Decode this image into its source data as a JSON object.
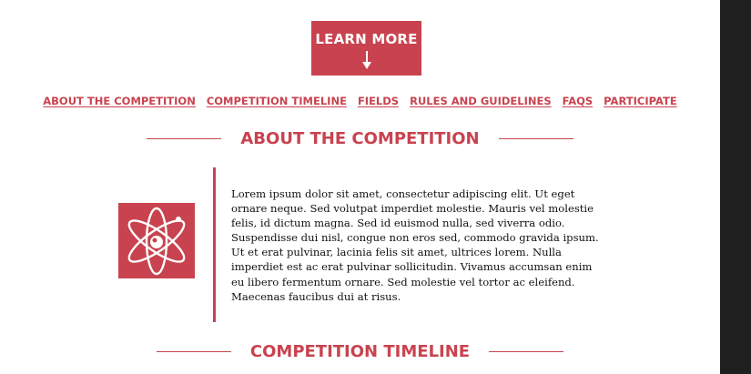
{
  "cta": {
    "label": "LEARN MORE",
    "icon": "arrow-down-icon"
  },
  "nav": {
    "items": [
      {
        "label": "About the Competition"
      },
      {
        "label": "Competition Timeline"
      },
      {
        "label": "Fields"
      },
      {
        "label": "Rules and Guidelines"
      },
      {
        "label": "FAQs"
      },
      {
        "label": "Participate"
      }
    ]
  },
  "about": {
    "heading": "ABOUT THE COMPETITION",
    "logo_icon": "atom-icon",
    "body": "Lorem ipsum dolor sit amet, consectetur adipiscing elit. Ut eget ornare neque. Sed volutpat imperdiet molestie. Mauris vel molestie felis, id dictum magna. Sed id euismod nulla, sed viverra odio. Suspendisse dui nisl, congue non eros sed, commodo gravida ipsum. Ut et erat pulvinar, lacinia felis sit amet, ultrices lorem. Nulla imperdiet est ac erat pulvinar sollicitudin. Vivamus accumsan enim eu libero fermentum ornare. Sed molestie vel tortor ac eleifend. Maecenas faucibus dui at risus."
  },
  "timeline": {
    "heading": "COMPETITION TIMELINE"
  },
  "colors": {
    "accent": "#c8434f",
    "sidebar": "#1f1f1f",
    "text": "#111111"
  }
}
